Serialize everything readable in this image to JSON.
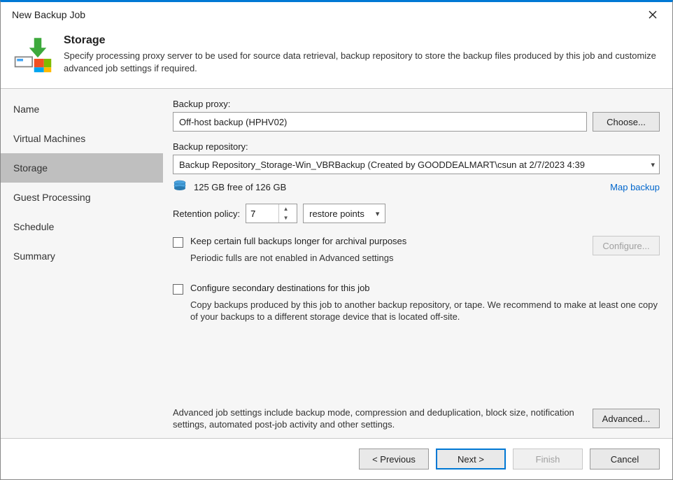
{
  "window": {
    "title": "New Backup Job"
  },
  "header": {
    "title": "Storage",
    "description": "Specify processing proxy server to be used for source data retrieval, backup repository to store the backup files produced by this job and customize advanced job settings if required."
  },
  "sidebar": {
    "items": [
      {
        "label": "Name"
      },
      {
        "label": "Virtual Machines"
      },
      {
        "label": "Storage",
        "active": true
      },
      {
        "label": "Guest Processing"
      },
      {
        "label": "Schedule"
      },
      {
        "label": "Summary"
      }
    ]
  },
  "main": {
    "proxy_label": "Backup proxy:",
    "proxy_value": "Off-host backup (HPHV02)",
    "choose_button": "Choose...",
    "repo_label": "Backup repository:",
    "repo_value": "Backup Repository_Storage-Win_VBRBackup (Created by GOODDEALMART\\csun at 2/7/2023 4:39",
    "free_text": "125 GB free of 126 GB",
    "map_backup": "Map backup",
    "retention_label": "Retention policy:",
    "retention_value": "7",
    "retention_unit": "restore points",
    "keep_full_label": "Keep certain full backups longer for archival purposes",
    "keep_full_hint": "Periodic fulls are not enabled in Advanced settings",
    "configure_button": "Configure...",
    "secondary_label": "Configure secondary destinations for this job",
    "secondary_desc": "Copy backups produced by this job to another backup repository, or tape. We recommend to make at least one copy of your backups to a different storage device that is located off-site.",
    "advanced_desc": "Advanced job settings include backup mode, compression and deduplication, block size, notification settings, automated post-job activity and other settings.",
    "advanced_button": "Advanced..."
  },
  "footer": {
    "previous": "< Previous",
    "next": "Next >",
    "finish": "Finish",
    "cancel": "Cancel"
  }
}
